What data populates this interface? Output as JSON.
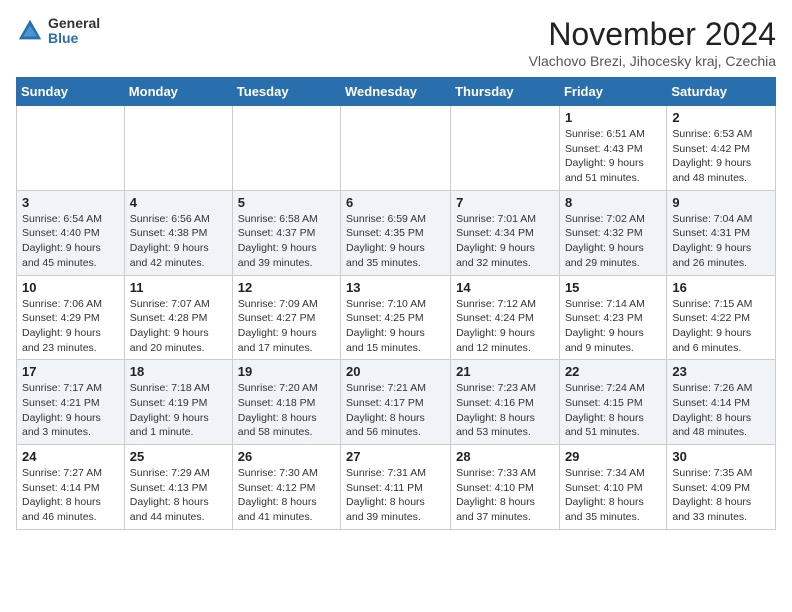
{
  "logo": {
    "general": "General",
    "blue": "Blue"
  },
  "title": "November 2024",
  "subtitle": "Vlachovo Brezi, Jihocesky kraj, Czechia",
  "days_of_week": [
    "Sunday",
    "Monday",
    "Tuesday",
    "Wednesday",
    "Thursday",
    "Friday",
    "Saturday"
  ],
  "weeks": [
    [
      {
        "day": "",
        "info": ""
      },
      {
        "day": "",
        "info": ""
      },
      {
        "day": "",
        "info": ""
      },
      {
        "day": "",
        "info": ""
      },
      {
        "day": "",
        "info": ""
      },
      {
        "day": "1",
        "info": "Sunrise: 6:51 AM\nSunset: 4:43 PM\nDaylight: 9 hours and 51 minutes."
      },
      {
        "day": "2",
        "info": "Sunrise: 6:53 AM\nSunset: 4:42 PM\nDaylight: 9 hours and 48 minutes."
      }
    ],
    [
      {
        "day": "3",
        "info": "Sunrise: 6:54 AM\nSunset: 4:40 PM\nDaylight: 9 hours and 45 minutes."
      },
      {
        "day": "4",
        "info": "Sunrise: 6:56 AM\nSunset: 4:38 PM\nDaylight: 9 hours and 42 minutes."
      },
      {
        "day": "5",
        "info": "Sunrise: 6:58 AM\nSunset: 4:37 PM\nDaylight: 9 hours and 39 minutes."
      },
      {
        "day": "6",
        "info": "Sunrise: 6:59 AM\nSunset: 4:35 PM\nDaylight: 9 hours and 35 minutes."
      },
      {
        "day": "7",
        "info": "Sunrise: 7:01 AM\nSunset: 4:34 PM\nDaylight: 9 hours and 32 minutes."
      },
      {
        "day": "8",
        "info": "Sunrise: 7:02 AM\nSunset: 4:32 PM\nDaylight: 9 hours and 29 minutes."
      },
      {
        "day": "9",
        "info": "Sunrise: 7:04 AM\nSunset: 4:31 PM\nDaylight: 9 hours and 26 minutes."
      }
    ],
    [
      {
        "day": "10",
        "info": "Sunrise: 7:06 AM\nSunset: 4:29 PM\nDaylight: 9 hours and 23 minutes."
      },
      {
        "day": "11",
        "info": "Sunrise: 7:07 AM\nSunset: 4:28 PM\nDaylight: 9 hours and 20 minutes."
      },
      {
        "day": "12",
        "info": "Sunrise: 7:09 AM\nSunset: 4:27 PM\nDaylight: 9 hours and 17 minutes."
      },
      {
        "day": "13",
        "info": "Sunrise: 7:10 AM\nSunset: 4:25 PM\nDaylight: 9 hours and 15 minutes."
      },
      {
        "day": "14",
        "info": "Sunrise: 7:12 AM\nSunset: 4:24 PM\nDaylight: 9 hours and 12 minutes."
      },
      {
        "day": "15",
        "info": "Sunrise: 7:14 AM\nSunset: 4:23 PM\nDaylight: 9 hours and 9 minutes."
      },
      {
        "day": "16",
        "info": "Sunrise: 7:15 AM\nSunset: 4:22 PM\nDaylight: 9 hours and 6 minutes."
      }
    ],
    [
      {
        "day": "17",
        "info": "Sunrise: 7:17 AM\nSunset: 4:21 PM\nDaylight: 9 hours and 3 minutes."
      },
      {
        "day": "18",
        "info": "Sunrise: 7:18 AM\nSunset: 4:19 PM\nDaylight: 9 hours and 1 minute."
      },
      {
        "day": "19",
        "info": "Sunrise: 7:20 AM\nSunset: 4:18 PM\nDaylight: 8 hours and 58 minutes."
      },
      {
        "day": "20",
        "info": "Sunrise: 7:21 AM\nSunset: 4:17 PM\nDaylight: 8 hours and 56 minutes."
      },
      {
        "day": "21",
        "info": "Sunrise: 7:23 AM\nSunset: 4:16 PM\nDaylight: 8 hours and 53 minutes."
      },
      {
        "day": "22",
        "info": "Sunrise: 7:24 AM\nSunset: 4:15 PM\nDaylight: 8 hours and 51 minutes."
      },
      {
        "day": "23",
        "info": "Sunrise: 7:26 AM\nSunset: 4:14 PM\nDaylight: 8 hours and 48 minutes."
      }
    ],
    [
      {
        "day": "24",
        "info": "Sunrise: 7:27 AM\nSunset: 4:14 PM\nDaylight: 8 hours and 46 minutes."
      },
      {
        "day": "25",
        "info": "Sunrise: 7:29 AM\nSunset: 4:13 PM\nDaylight: 8 hours and 44 minutes."
      },
      {
        "day": "26",
        "info": "Sunrise: 7:30 AM\nSunset: 4:12 PM\nDaylight: 8 hours and 41 minutes."
      },
      {
        "day": "27",
        "info": "Sunrise: 7:31 AM\nSunset: 4:11 PM\nDaylight: 8 hours and 39 minutes."
      },
      {
        "day": "28",
        "info": "Sunrise: 7:33 AM\nSunset: 4:10 PM\nDaylight: 8 hours and 37 minutes."
      },
      {
        "day": "29",
        "info": "Sunrise: 7:34 AM\nSunset: 4:10 PM\nDaylight: 8 hours and 35 minutes."
      },
      {
        "day": "30",
        "info": "Sunrise: 7:35 AM\nSunset: 4:09 PM\nDaylight: 8 hours and 33 minutes."
      }
    ]
  ]
}
